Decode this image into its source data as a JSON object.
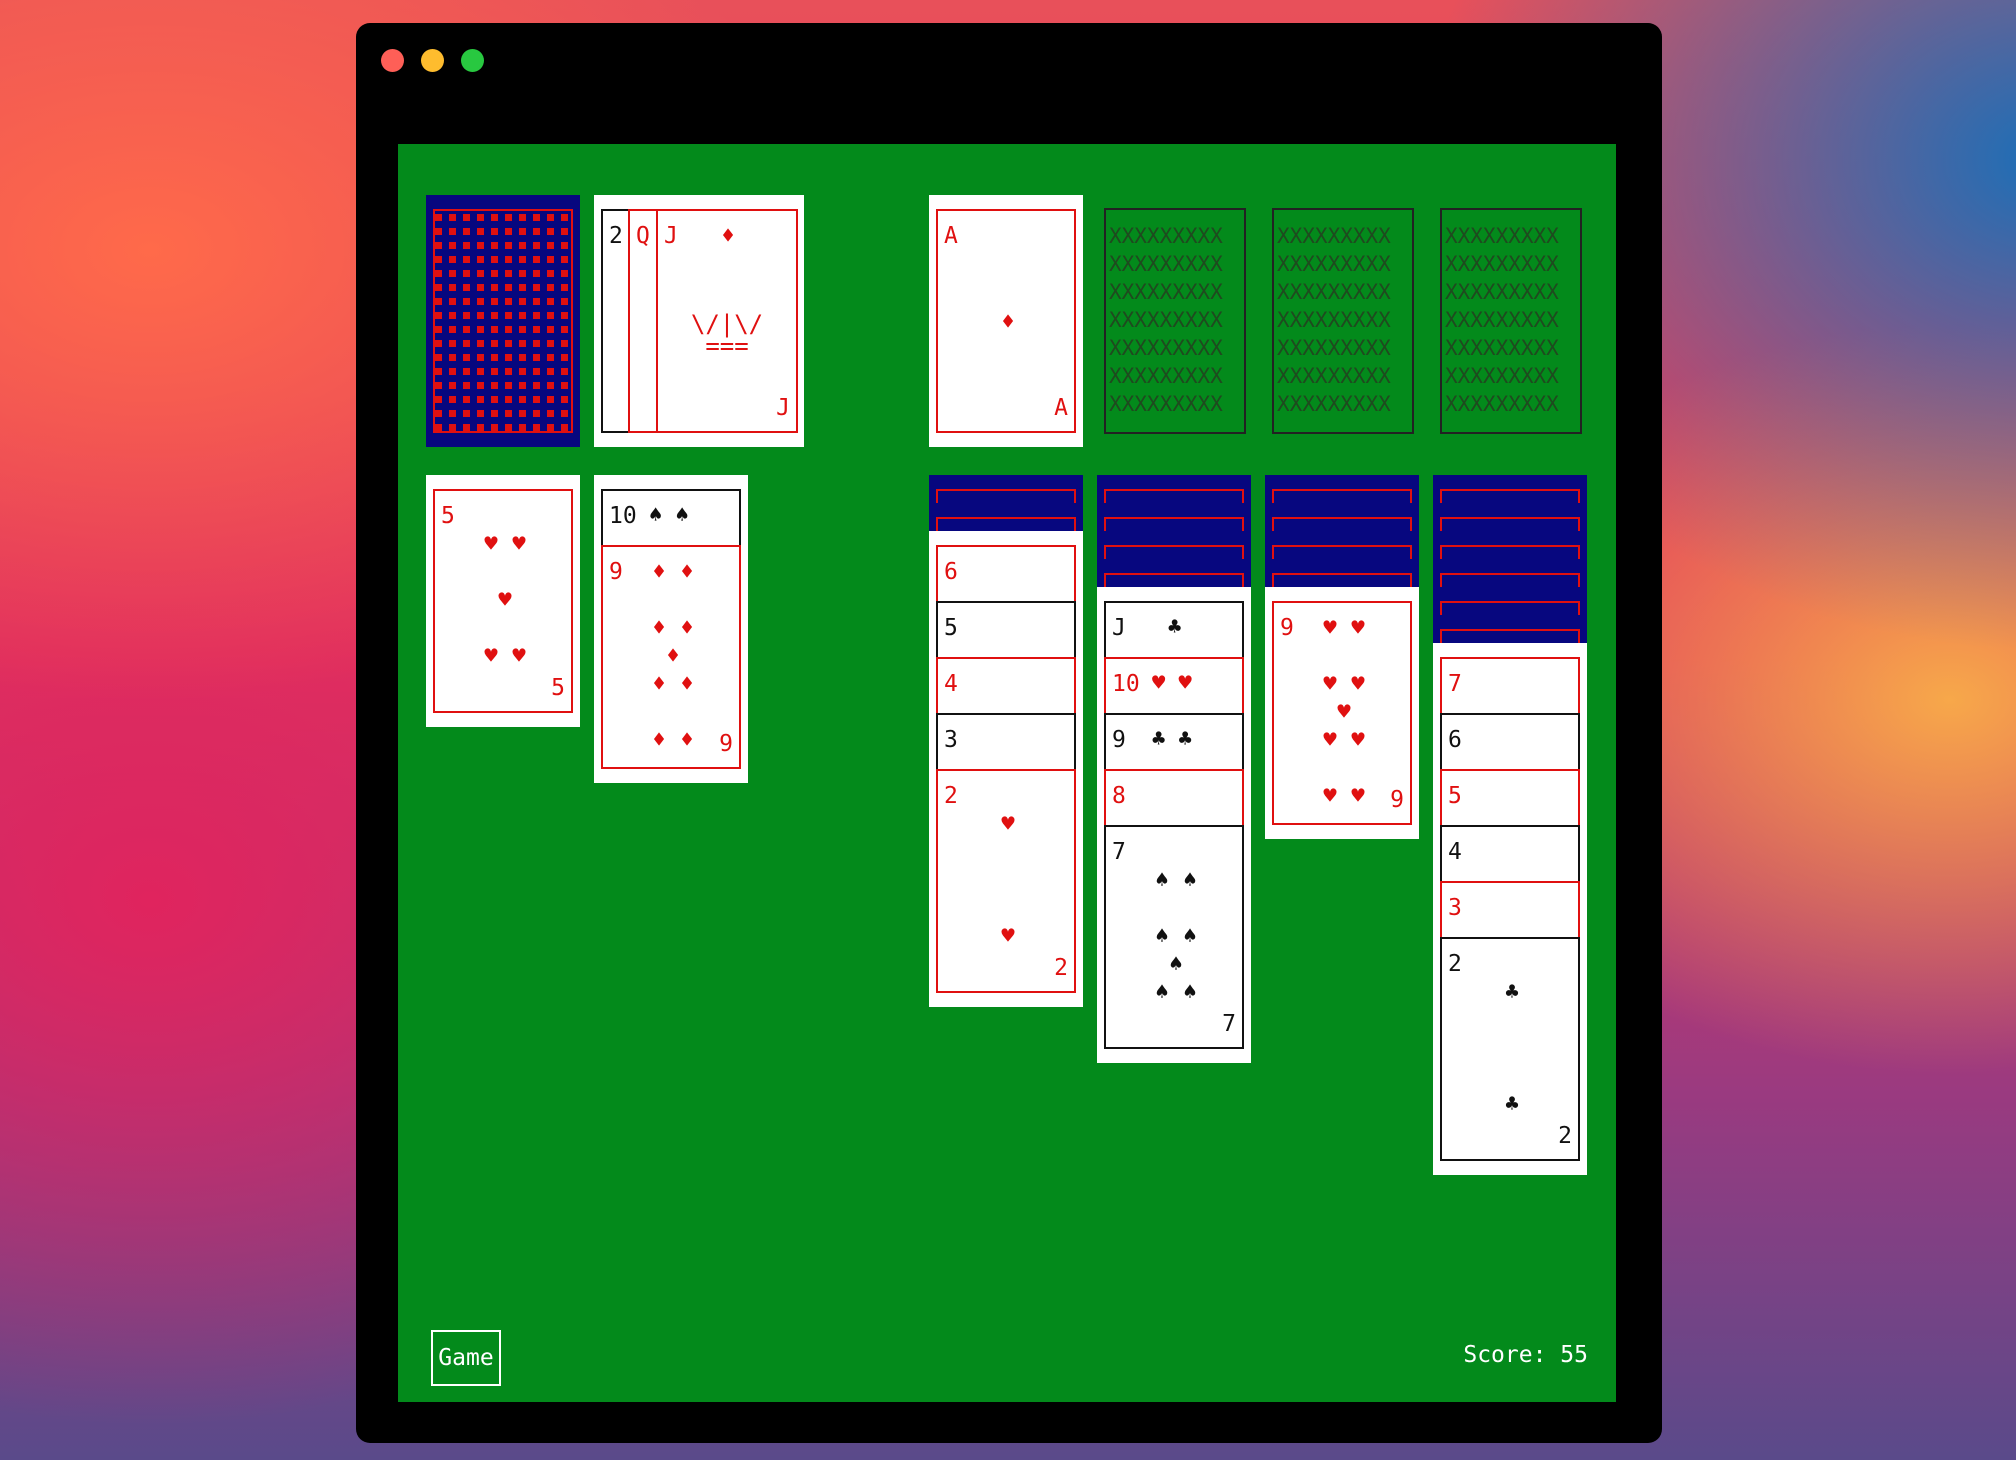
{
  "score": {
    "label": "Score:",
    "value": "55"
  },
  "menu": {
    "game_label": "Game"
  },
  "stock": {
    "face_down": true
  },
  "waste": {
    "stub_ranks": [
      "2",
      "Q"
    ],
    "top": {
      "rank": "J",
      "suit": "♦",
      "art_line1": "\\/|\\/",
      "art_line2": "==="
    }
  },
  "foundations": [
    {
      "rank": "A",
      "suit": "♦"
    },
    {
      "empty_pattern": "XXXXXXXXX\nXXXXXXXXX\nXXXXXXXXX\nXXXXXXXXX\nXXXXXXXXX\nXXXXXXXXX\nXXXXXXXXX"
    },
    {
      "empty_pattern": "XXXXXXXXX\nXXXXXXXXX\nXXXXXXXXX\nXXXXXXXXX\nXXXXXXXXX\nXXXXXXXXX\nXXXXXXXXX"
    },
    {
      "empty_pattern": "XXXXXXXXX\nXXXXXXXXX\nXXXXXXXXX\nXXXXXXXXX\nXXXXXXXXX\nXXXXXXXXX\nXXXXXXXXX"
    }
  ],
  "tableau_left": {
    "col1": {
      "rank": "5",
      "suit": "♥"
    },
    "col2": {
      "stub": {
        "rank": "10",
        "suit": "♠ ♠"
      },
      "top": {
        "rank": "9",
        "suit": "♦"
      }
    }
  },
  "tableau": [
    {
      "hidden": 2,
      "stubs": [
        {
          "rank": "6",
          "color": "red",
          "suits": ""
        },
        {
          "rank": "5",
          "color": "black",
          "suits": ""
        },
        {
          "rank": "4",
          "color": "red",
          "suits": ""
        },
        {
          "rank": "3",
          "color": "black",
          "suits": ""
        }
      ],
      "top": {
        "rank": "2",
        "suit": "♥",
        "color": "red"
      }
    },
    {
      "hidden": 4,
      "stubs": [
        {
          "rank": "J",
          "color": "black",
          "suits": "♣"
        },
        {
          "rank": "10",
          "color": "red",
          "suits": "♥ ♥"
        },
        {
          "rank": "9",
          "color": "black",
          "suits": "♣ ♣"
        },
        {
          "rank": "8",
          "color": "red",
          "suits": ""
        }
      ],
      "top": {
        "rank": "7",
        "suit": "♠",
        "color": "black"
      }
    },
    {
      "hidden": 4,
      "stubs": [],
      "top": {
        "rank": "9",
        "suit": "♥",
        "color": "red"
      }
    },
    {
      "hidden": 6,
      "stubs": [
        {
          "rank": "7",
          "color": "red",
          "suits": ""
        },
        {
          "rank": "6",
          "color": "black",
          "suits": ""
        },
        {
          "rank": "5",
          "color": "red",
          "suits": ""
        },
        {
          "rank": "4",
          "color": "black",
          "suits": ""
        },
        {
          "rank": "3",
          "color": "red",
          "suits": ""
        }
      ],
      "top": {
        "rank": "2",
        "suit": "♣",
        "color": "black"
      }
    }
  ]
}
